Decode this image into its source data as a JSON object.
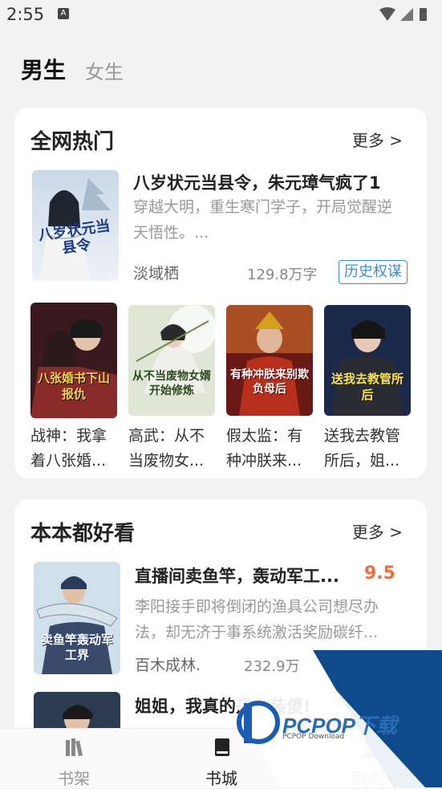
{
  "status_bar": {
    "time": "2:55",
    "notif_icon": "A"
  },
  "tabs": {
    "male": "男生",
    "female": "女生"
  },
  "section1": {
    "title": "全网热门",
    "more": "更多 >",
    "featured": {
      "title": "八岁状元当县令，朱元璋气疯了1",
      "desc": "穿越大明，重生寒门学子，开局觉醒逆天悟性。...",
      "author": "淡域栖",
      "words": "129.8万字",
      "tag": "历史权谋",
      "cover_text": "八岁状元当县令"
    },
    "grid": [
      {
        "title": "战神：我拿着八张婚...",
        "cover_text": "八张婚书下山报仇"
      },
      {
        "title": "高武：从不当废物女...",
        "cover_text": "从不当废物女婿开始修炼"
      },
      {
        "title": "假太监：有种冲朕来...",
        "cover_text": "有种冲朕来别欺负母后"
      },
      {
        "title": "送我去教管所后，姐...",
        "cover_text": "送我去教管所后"
      }
    ]
  },
  "section2": {
    "title": "本本都好看",
    "more": "更多 >",
    "books": [
      {
        "title": "直播间卖鱼竿，轰动军工...",
        "score": "9.5",
        "desc": "李阳接手即将倒闭的渔具公司想尽办法，却无济于事系统激活奖励碳纤...",
        "author": "百木成林.",
        "words": "232.9万",
        "cover_text": "卖鱼竿轰动军工界"
      },
      {
        "title": "姐姐，我真的是在装傻!"
      }
    ]
  },
  "bottom_nav": [
    {
      "label": "书架",
      "icon": "bookshelf-icon"
    },
    {
      "label": "书城",
      "icon": "book-icon"
    },
    {
      "label": "我的",
      "icon": "profile-icon"
    }
  ],
  "watermark": {
    "text": "PCPOP下载",
    "sub": "PCPOP Download"
  }
}
